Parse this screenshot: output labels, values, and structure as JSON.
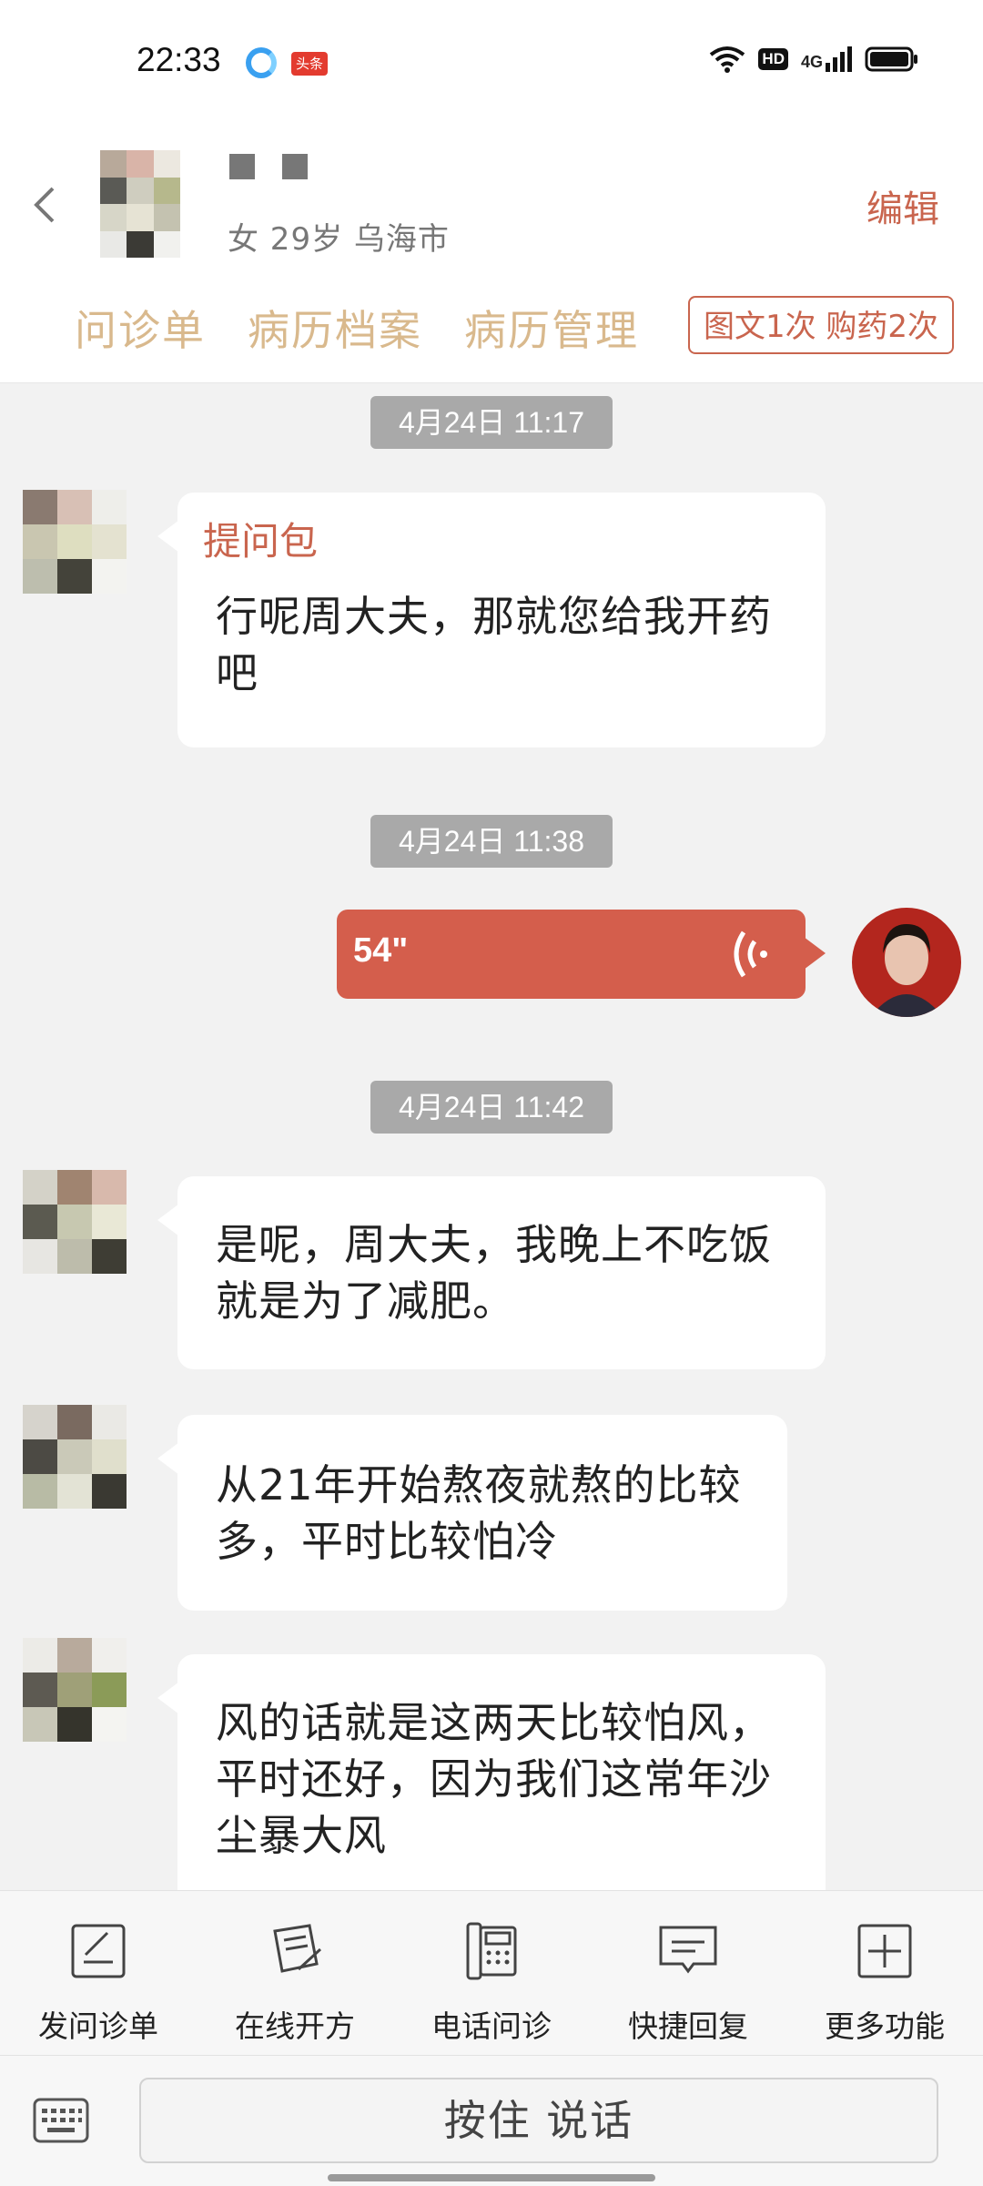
{
  "status_bar": {
    "time": "22:33",
    "icons": [
      "app-notification-icon",
      "toutiao-icon",
      "wifi-icon",
      "hd-icon",
      "4g-signal-icon",
      "battery-icon"
    ],
    "app_badge": "头条",
    "hd": "HD",
    "network": "4G"
  },
  "header": {
    "patient_info": "女 29岁  乌海市",
    "edit_label": "编辑",
    "tabs": [
      {
        "label": "问诊单"
      },
      {
        "label": "病历档案"
      },
      {
        "label": "病历管理"
      }
    ],
    "consult_badge": "图文1次 购药2次"
  },
  "chat": {
    "messages": [
      {
        "timestamp": "4月24日 11:17",
        "side": "left",
        "title": "提问包",
        "text": "行呢周大夫，那就您给我开药吧"
      },
      {
        "timestamp": "4月24日 11:38",
        "side": "right",
        "type": "voice",
        "duration": "54\""
      },
      {
        "timestamp": "4月24日 11:42",
        "side": "left",
        "text": "是呢，周大夫，我晚上不吃饭就是为了减肥。"
      },
      {
        "side": "left",
        "text": "从21年开始熬夜就熬的比较多，平时比较怕冷"
      },
      {
        "side": "left",
        "text": "风的话就是这两天比较怕风，平时还好，因为我们这常年沙尘暴大风"
      }
    ]
  },
  "toolbar": {
    "items": [
      {
        "label": "发问诊单",
        "icon": "form-edit-icon"
      },
      {
        "label": "在线开方",
        "icon": "prescription-icon"
      },
      {
        "label": "电话问诊",
        "icon": "phone-icon"
      },
      {
        "label": "快捷回复",
        "icon": "quick-reply-icon"
      },
      {
        "label": "更多功能",
        "icon": "plus-box-icon"
      }
    ]
  },
  "input": {
    "talk_label": "按住 说话"
  },
  "colors": {
    "accent": "#c9654e",
    "voice_bubble": "#d45e4c",
    "tab_text": "#d9b98d",
    "timestamp_bg": "#a9a9a9",
    "chat_bg": "#f2f2f2"
  }
}
